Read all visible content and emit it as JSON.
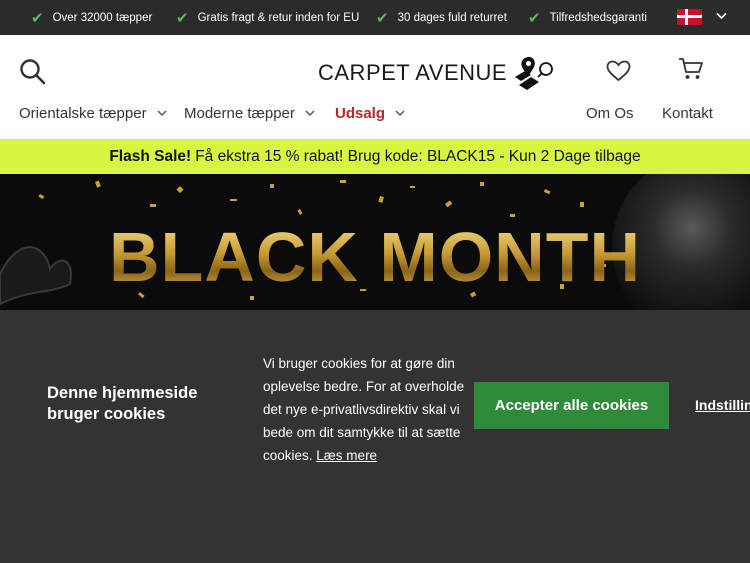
{
  "usp_bar": {
    "items": [
      {
        "label": "Over 32000 tæpper"
      },
      {
        "label": "Gratis fragt & retur inden for EU"
      },
      {
        "label": "30 dages fuld returret"
      },
      {
        "label": "Tilfredshedsgaranti"
      }
    ],
    "check_icon": "✔",
    "language_flag": "danish-flag-icon"
  },
  "header": {
    "logo_text": "CARPET AVENUE",
    "nav": [
      {
        "label": "Orientalske tæpper"
      },
      {
        "label": "Moderne tæpper"
      },
      {
        "label": "Udsalg"
      },
      {
        "label": "Om Os"
      },
      {
        "label": "Kontakt"
      }
    ],
    "icons": [
      "search-icon",
      "heart-icon",
      "cart-icon"
    ]
  },
  "flash_sale": {
    "bold": "Flash Sale!",
    "text": "Få ekstra 15 % rabat! Brug kode: BLACK15 - Kun 2 Dage tilbage"
  },
  "hero": {
    "title": "BLACK MONTH"
  },
  "cookie": {
    "title": "Denne hjemmeside bruger cookies",
    "text": "Vi bruger cookies for at gøre din oplevelse bedre. For at overholde det nye e-privatlivsdirektiv skal vi bede om dit samtykke til at sætte cookies.",
    "more_link": "Læs mere",
    "accept": "Accepter alle cookies",
    "settings": "Indstillinger"
  },
  "colors": {
    "usp_bar_bg": "#2b2b2b",
    "check_green": "#56c35a",
    "sale_red": "#b8262d",
    "flash_bg": "#d9f542",
    "cookie_bg": "#333333",
    "accept_green": "#2e8b3a",
    "gold": "#c79a33"
  }
}
